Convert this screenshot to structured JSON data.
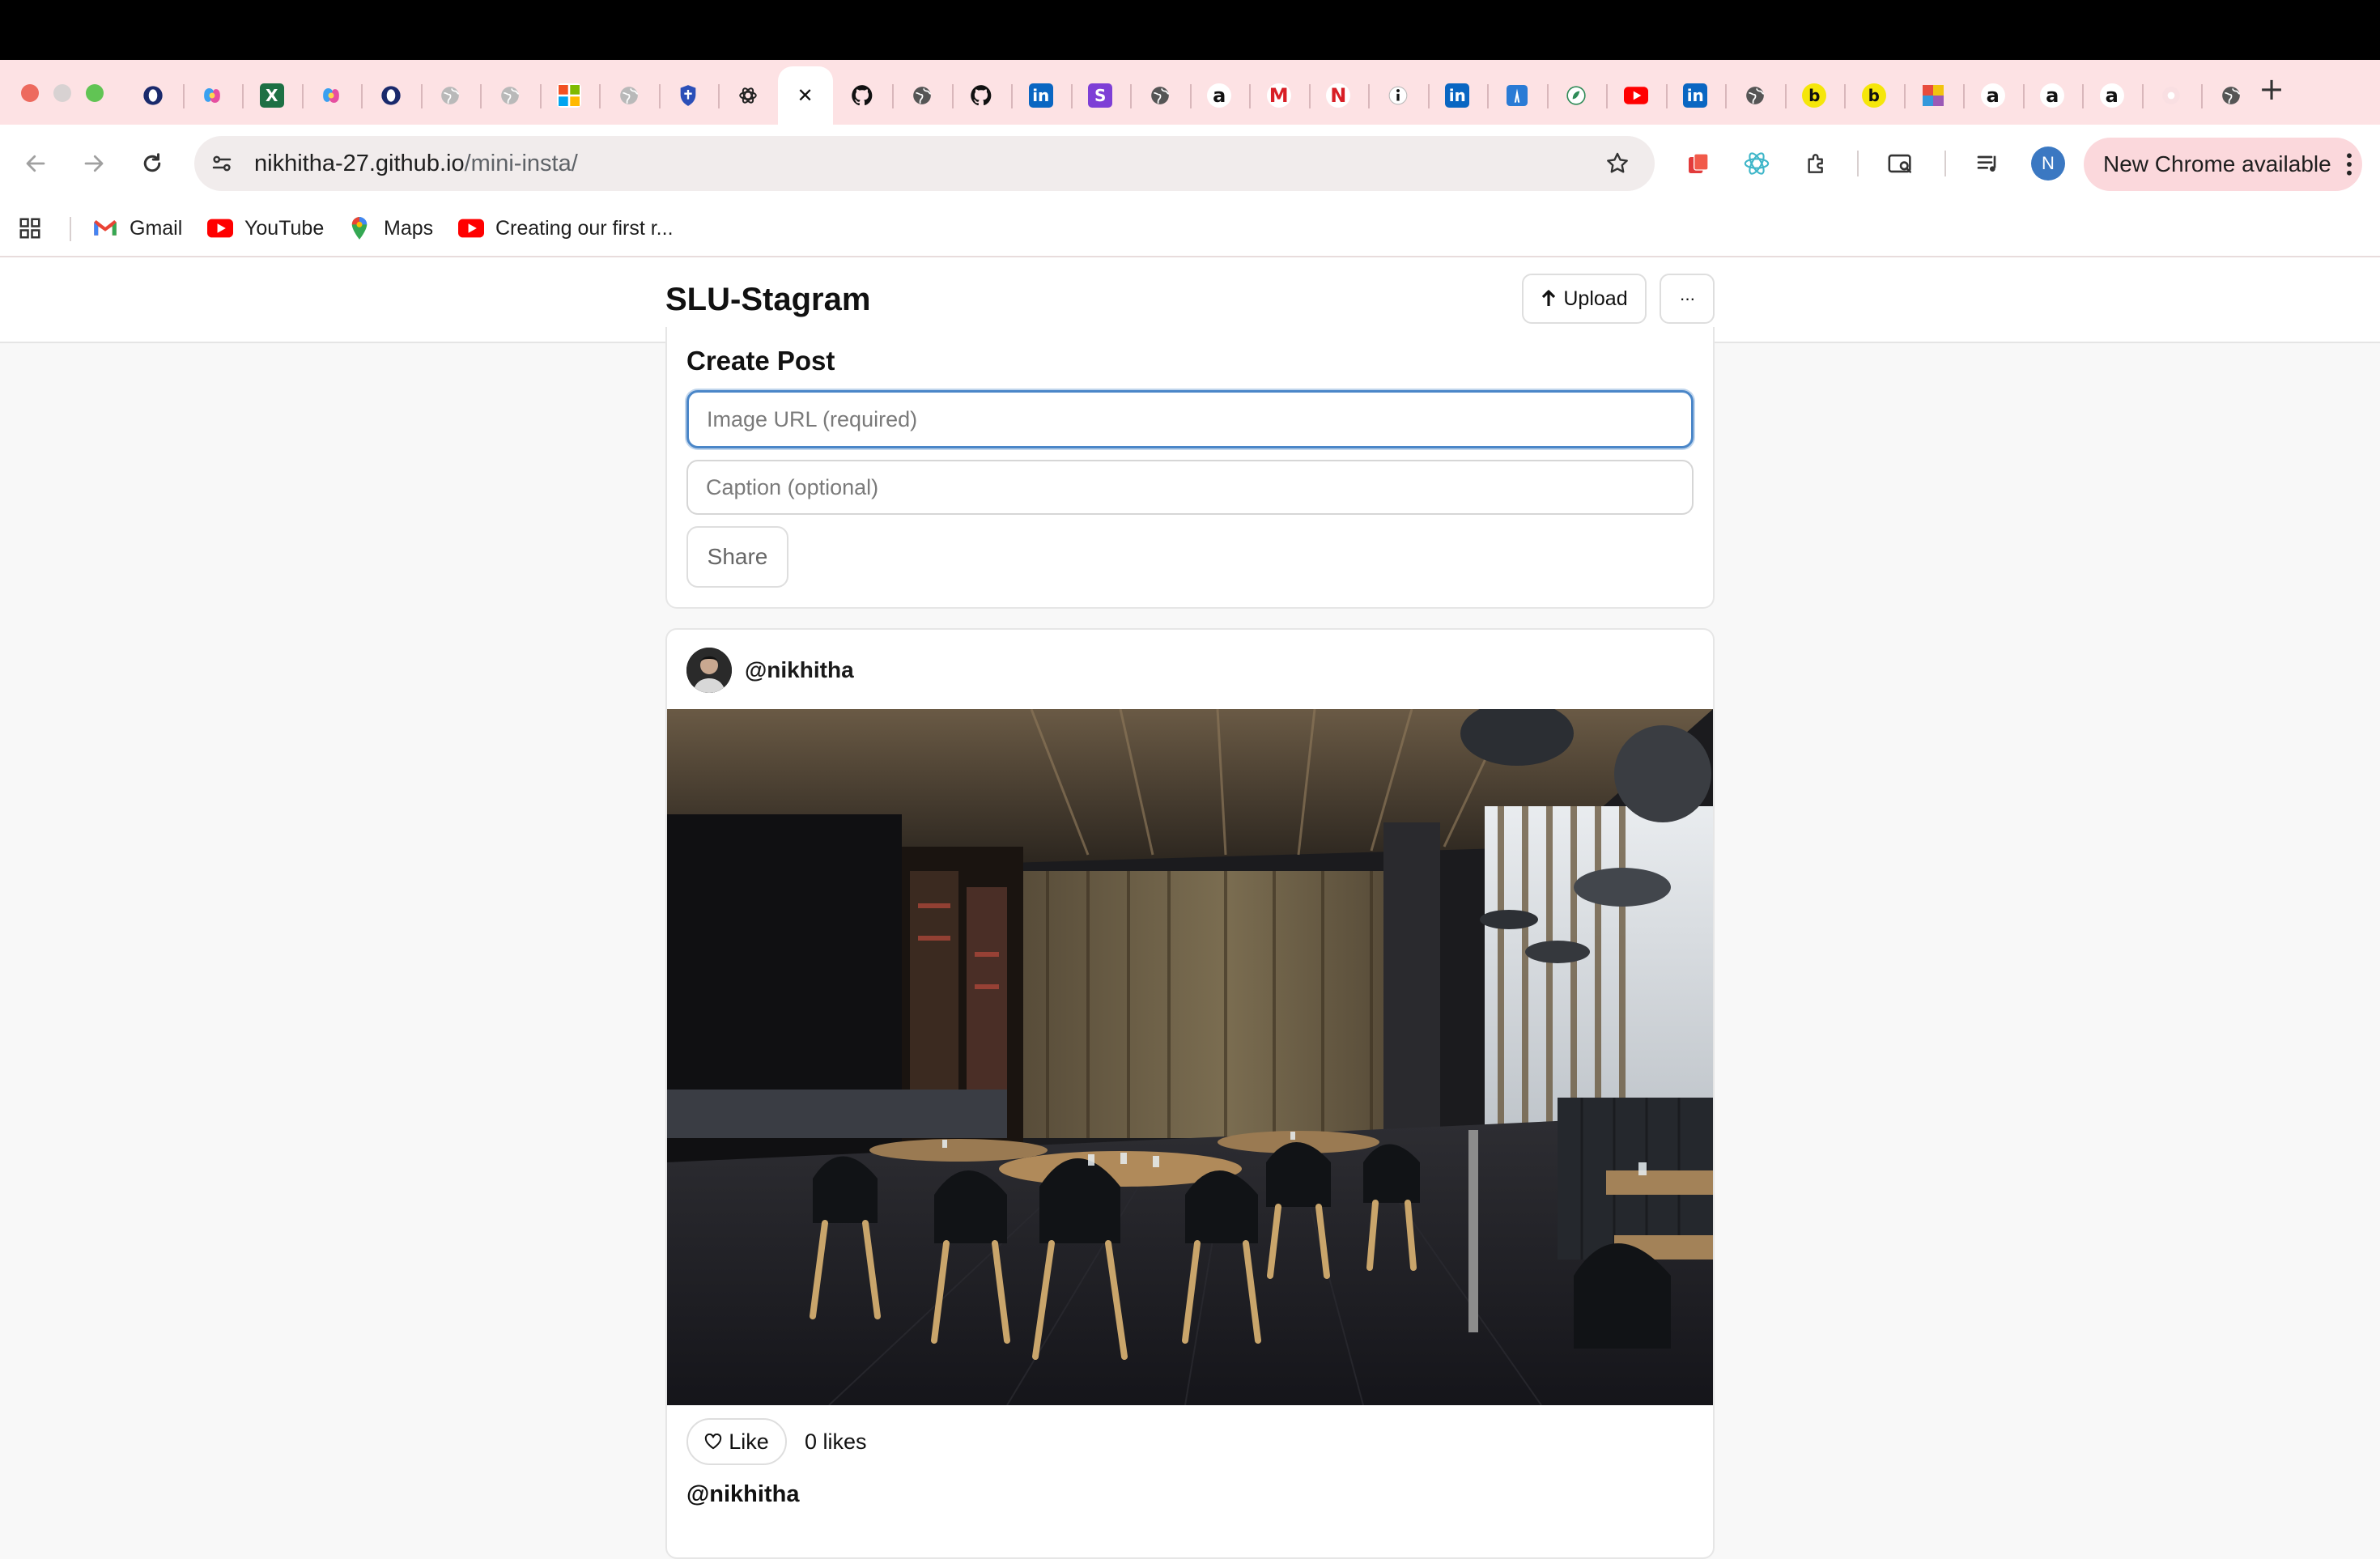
{
  "browser": {
    "tabs": [
      {
        "icon": "opera-icon",
        "glyph": "O",
        "bg": "#1a2a6c"
      },
      {
        "icon": "copilot-icon",
        "glyph": "",
        "bg": "#7b61ff"
      },
      {
        "icon": "excel-icon",
        "glyph": "X",
        "bg": "#1d7044"
      },
      {
        "icon": "copilot-icon",
        "glyph": "",
        "bg": "#7b61ff"
      },
      {
        "icon": "opera-icon",
        "glyph": "O",
        "bg": "#1a2a6c"
      },
      {
        "icon": "globe-icon",
        "glyph": "",
        "bg": "#b9b9b9"
      },
      {
        "icon": "globe-icon",
        "glyph": "",
        "bg": "#b9b9b9"
      },
      {
        "icon": "microsoft-icon",
        "glyph": "",
        "bg": "#ffffff"
      },
      {
        "icon": "globe-icon",
        "glyph": "",
        "bg": "#b9b9b9"
      },
      {
        "icon": "shield-icon",
        "glyph": "",
        "bg": "#2b4fb8"
      },
      {
        "icon": "openai-icon",
        "glyph": "",
        "bg": "#222222"
      },
      {
        "icon": "close-icon",
        "glyph": "✕",
        "bg": "#ffffff",
        "active": true
      },
      {
        "icon": "github-icon",
        "glyph": "",
        "bg": "#111111"
      },
      {
        "icon": "globe-icon",
        "glyph": "",
        "bg": "#555555"
      },
      {
        "icon": "github-icon",
        "glyph": "",
        "bg": "#111111"
      },
      {
        "icon": "linkedin-icon",
        "glyph": "in",
        "bg": "#0a66c2"
      },
      {
        "icon": "s-icon",
        "glyph": "S",
        "bg": "#7e3fd6"
      },
      {
        "icon": "globe-icon",
        "glyph": "",
        "bg": "#555555"
      },
      {
        "icon": "amazon-icon",
        "glyph": "a",
        "bg": "#ffffff"
      },
      {
        "icon": "gmail-icon",
        "glyph": "M",
        "bg": "#ffffff"
      },
      {
        "icon": "netflix-icon",
        "glyph": "N",
        "bg": "#ffffff"
      },
      {
        "icon": "info-icon",
        "glyph": "i",
        "bg": "#ffffff"
      },
      {
        "icon": "linkedin-icon",
        "glyph": "in",
        "bg": "#0a66c2"
      },
      {
        "icon": "figure-icon",
        "glyph": "",
        "bg": "#2a7bd5"
      },
      {
        "icon": "leaf-icon",
        "glyph": "",
        "bg": "#ffffff"
      },
      {
        "icon": "youtube-icon",
        "glyph": "",
        "bg": "#ff0000"
      },
      {
        "icon": "linkedin-icon",
        "glyph": "in",
        "bg": "#0a66c2"
      },
      {
        "icon": "globe-icon",
        "glyph": "",
        "bg": "#555555"
      },
      {
        "icon": "b-icon",
        "glyph": "b",
        "bg": "#f5e60a"
      },
      {
        "icon": "b-icon",
        "glyph": "b",
        "bg": "#f5e60a"
      },
      {
        "icon": "grid-color-icon",
        "glyph": "",
        "bg": "#e85aa0"
      },
      {
        "icon": "amazon-icon",
        "glyph": "a",
        "bg": "#ffffff"
      },
      {
        "icon": "amazon-icon",
        "glyph": "a",
        "bg": "#ffffff"
      },
      {
        "icon": "amazon-icon",
        "glyph": "a",
        "bg": "#ffffff"
      },
      {
        "icon": "flower-icon",
        "glyph": "",
        "bg": "#f4d8dc"
      },
      {
        "icon": "globe-icon",
        "glyph": "",
        "bg": "#555555"
      }
    ],
    "address": {
      "host": "nikhitha-27.github.io",
      "path": "/mini-insta/"
    },
    "profile_initial": "N",
    "update_label": "New Chrome available",
    "bookmarks": [
      {
        "label": "Gmail",
        "icon": "gmail-icon"
      },
      {
        "label": "YouTube",
        "icon": "youtube-icon"
      },
      {
        "label": "Maps",
        "icon": "maps-pin-icon"
      },
      {
        "label": "Creating our first r...",
        "icon": "youtube-icon"
      }
    ]
  },
  "app": {
    "brand": "SLU-Stagram",
    "upload_label": "Upload",
    "more_label": "···",
    "create": {
      "title": "Create Post",
      "image_placeholder": "Image URL (required)",
      "caption_placeholder": "Caption (optional)",
      "share_label": "Share"
    },
    "post": {
      "username": "@nikhitha",
      "like_label": "Like",
      "likes_text": "0 likes",
      "caption_username": "@nikhitha"
    }
  }
}
